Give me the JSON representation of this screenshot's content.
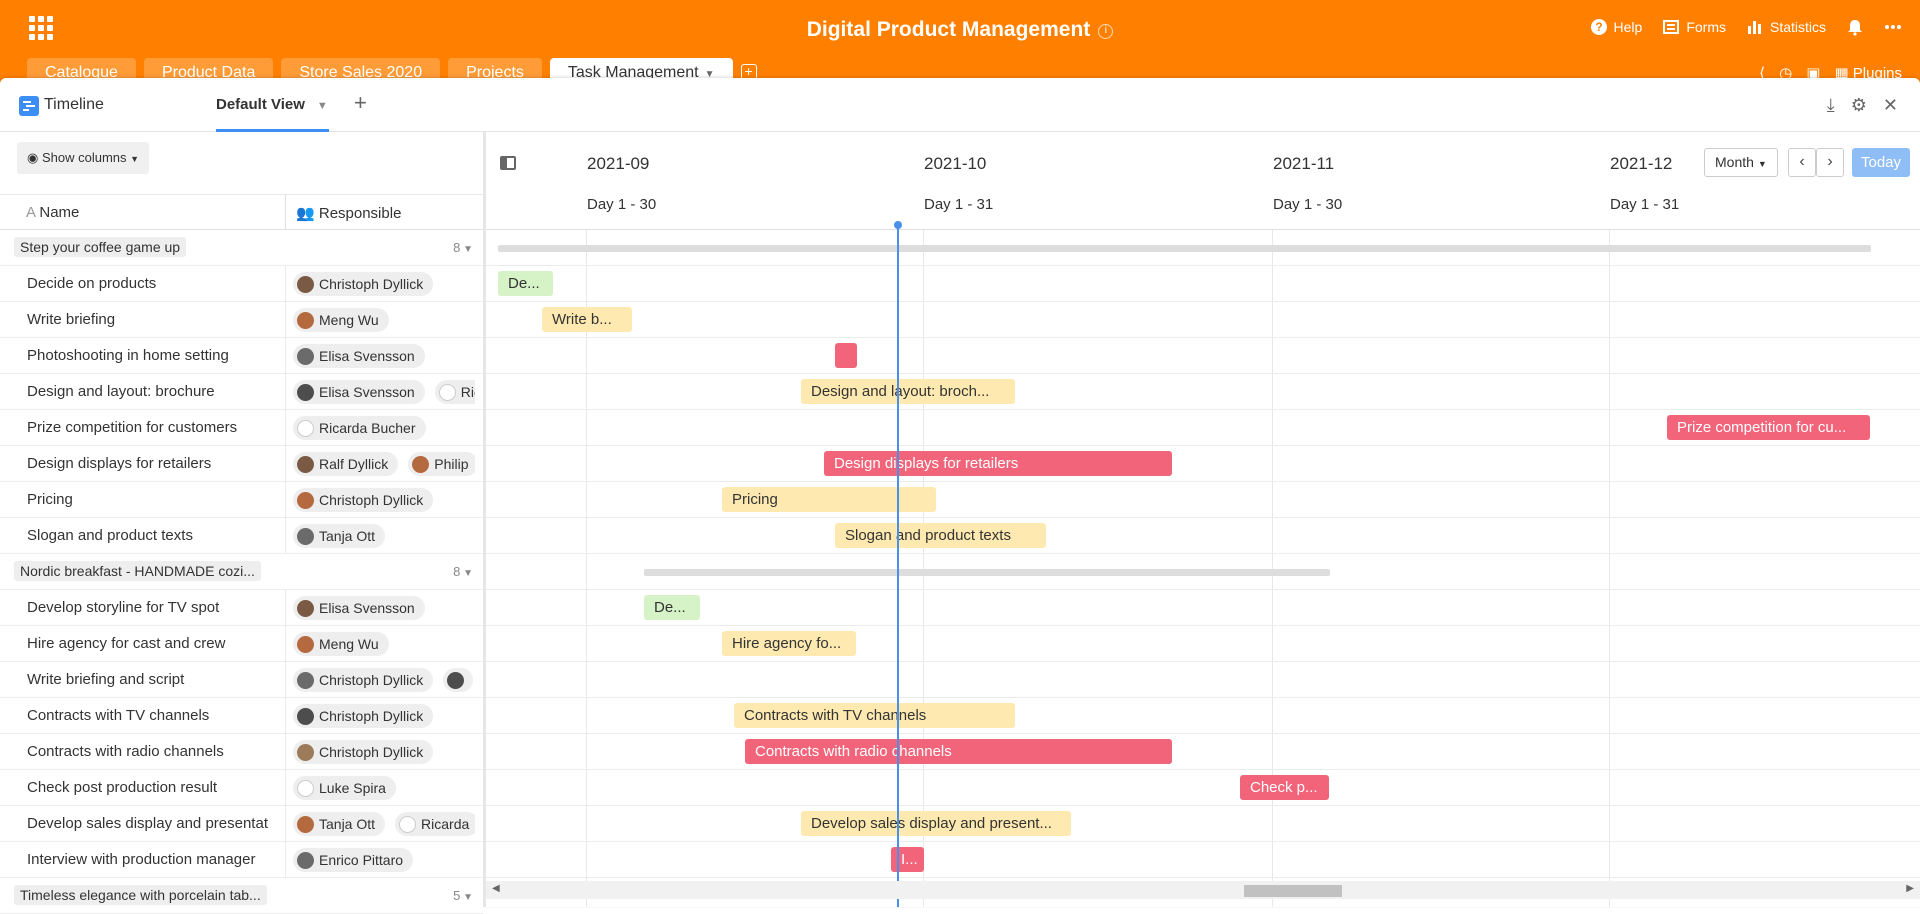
{
  "app": {
    "title": "Digital Product Management",
    "actions": [
      {
        "label": "Help",
        "icon": "help-icon"
      },
      {
        "label": "Forms",
        "icon": "forms-icon"
      },
      {
        "label": "Statistics",
        "icon": "statistics-icon"
      }
    ],
    "plugins_label": "Plugins"
  },
  "tabs": [
    {
      "label": "Catalogue"
    },
    {
      "label": "Product Data"
    },
    {
      "label": "Store Sales 2020"
    },
    {
      "label": "Projects"
    },
    {
      "label": "Task Management",
      "active": true
    }
  ],
  "view": {
    "type_label": "Timeline",
    "name": "Default View",
    "show_columns_label": "Show columns"
  },
  "columns": {
    "name": "Name",
    "responsible": "Responsible"
  },
  "timeline": {
    "months": [
      "2021-09",
      "2021-10",
      "2021-11",
      "2021-12"
    ],
    "day_ranges": [
      "Day 1 - 30",
      "Day 1 - 31",
      "Day 1 - 30",
      "Day 1 - 31"
    ],
    "zoom_label": "Month",
    "today_label": "Today"
  },
  "groups": [
    {
      "name": "Step your coffee game up",
      "count": "8",
      "rows": [
        {
          "name": "Decide on products",
          "people": [
            "Christoph Dyllick"
          ],
          "bar": {
            "label": "De...",
            "color": "green"
          }
        },
        {
          "name": "Write briefing",
          "people": [
            "Meng Wu"
          ],
          "bar": {
            "label": "Write b...",
            "color": "yellow"
          }
        },
        {
          "name": "Photoshooting in home setting",
          "people": [
            "Elisa Svensson"
          ],
          "bar": {
            "label": "",
            "color": "red"
          }
        },
        {
          "name": "Design and layout: brochure",
          "people": [
            "Elisa Svensson",
            "Ric"
          ],
          "bar": {
            "label": "Design and layout: broch...",
            "color": "yellow"
          }
        },
        {
          "name": "Prize competition for customers",
          "people": [
            "Ricarda Bucher"
          ],
          "bar": {
            "label": "Prize competition for cu...",
            "color": "red"
          }
        },
        {
          "name": "Design displays for retailers",
          "people": [
            "Ralf Dyllick",
            "Philip"
          ],
          "bar": {
            "label": "Design displays for retailers",
            "color": "red"
          }
        },
        {
          "name": "Pricing",
          "people": [
            "Christoph Dyllick"
          ],
          "bar": {
            "label": "Pricing",
            "color": "yellow"
          }
        },
        {
          "name": "Slogan and product texts",
          "people": [
            "Tanja Ott"
          ],
          "bar": {
            "label": "Slogan and product texts",
            "color": "yellow"
          }
        }
      ]
    },
    {
      "name": "Nordic breakfast - HANDMADE cozi...",
      "count": "8",
      "rows": [
        {
          "name": "Develop storyline for TV spot",
          "people": [
            "Elisa Svensson"
          ],
          "bar": {
            "label": "De...",
            "color": "green"
          }
        },
        {
          "name": "Hire agency for cast and crew",
          "people": [
            "Meng Wu"
          ],
          "bar": {
            "label": "Hire agency fo...",
            "color": "yellow"
          }
        },
        {
          "name": "Write briefing and script",
          "people": [
            "Christoph Dyllick",
            ""
          ],
          "bar": null
        },
        {
          "name": "Contracts with TV channels",
          "people": [
            "Christoph Dyllick"
          ],
          "bar": {
            "label": "Contracts with TV channels",
            "color": "yellow"
          }
        },
        {
          "name": "Contracts with radio channels",
          "people": [
            "Christoph Dyllick"
          ],
          "bar": {
            "label": "Contracts with radio channels",
            "color": "red"
          }
        },
        {
          "name": "Check post production result",
          "people": [
            "Luke Spira"
          ],
          "bar": {
            "label": "Check p...",
            "color": "red"
          }
        },
        {
          "name": "Develop sales display and presentat",
          "people": [
            "Tanja Ott",
            "Ricarda"
          ],
          "bar": {
            "label": "Develop sales display and present...",
            "color": "yellow"
          }
        },
        {
          "name": "Interview with production manager",
          "people": [
            "Enrico Pittaro"
          ],
          "bar": {
            "label": "I...",
            "color": "red"
          }
        }
      ]
    },
    {
      "name": "Timeless elegance with porcelain tab...",
      "count": "5",
      "rows": []
    }
  ],
  "colors": {
    "brand": "#ff8000",
    "accent": "#3c8ef5",
    "bar_red": "#f2647a",
    "bar_yellow": "#feeab0",
    "bar_green": "#d6f2c7"
  }
}
